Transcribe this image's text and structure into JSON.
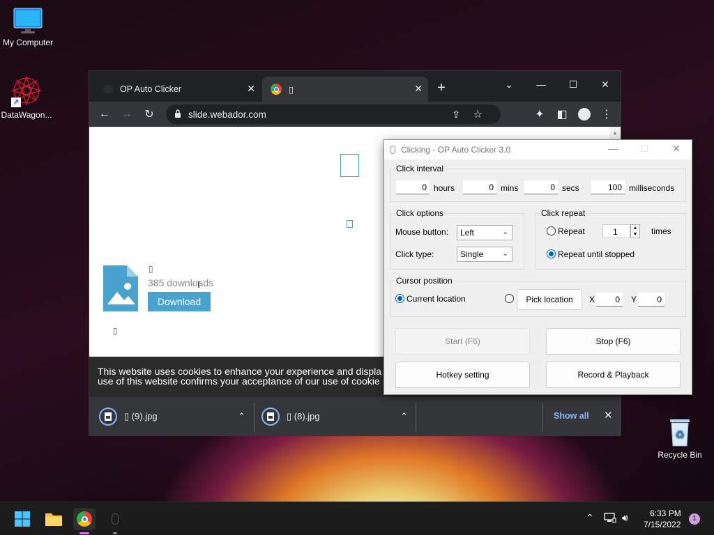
{
  "desktop": {
    "icons": [
      {
        "label": "My Computer"
      },
      {
        "label": "DataWagon..."
      },
      {
        "label": "Recycle Bin"
      }
    ]
  },
  "browser": {
    "tabs": [
      {
        "title": "OP Auto Clicker"
      },
      {
        "title": "▯"
      }
    ],
    "address": "slide.webador.com",
    "page": {
      "file_glyph": "▯",
      "downloads_count": "385 downloads",
      "download_button": "Download",
      "small_glyph": "▯"
    },
    "cookie_text_line1": "This website uses cookies to enhance your experience and displa",
    "cookie_text_line2": "use of this website confirms your acceptance of our use of cookie",
    "downloads": [
      {
        "name": "▯ (9).jpg"
      },
      {
        "name": "▯ (8).jpg"
      }
    ],
    "show_all": "Show all"
  },
  "clicker": {
    "title": "Clicking - OP Auto Clicker 3.0",
    "interval": {
      "label": "Click interval",
      "hours": "0",
      "hours_label": "hours",
      "mins": "0",
      "mins_label": "mins",
      "secs": "0",
      "secs_label": "secs",
      "ms": "100",
      "ms_label": "milliseconds"
    },
    "options": {
      "label": "Click options",
      "mouse_button_label": "Mouse button:",
      "mouse_button_value": "Left",
      "click_type_label": "Click type:",
      "click_type_value": "Single"
    },
    "repeat": {
      "label": "Click repeat",
      "repeat_label": "Repeat",
      "repeat_value": "1",
      "times_label": "times",
      "until_stopped_label": "Repeat until stopped",
      "selected": "until_stopped"
    },
    "cursor": {
      "label": "Cursor position",
      "current_label": "Current location",
      "pick_button": "Pick location",
      "x_label": "X",
      "x_value": "0",
      "y_label": "Y",
      "y_value": "0",
      "selected": "current"
    },
    "buttons": {
      "start": "Start (F6)",
      "stop": "Stop (F6)",
      "hotkey": "Hotkey setting",
      "record": "Record & Playback"
    }
  },
  "taskbar": {
    "time": "6:33 PM",
    "date": "7/15/2022",
    "notification_count": "1"
  },
  "colors": {
    "accent_blue": "#0060c0",
    "download_btn": "#4aa3cf",
    "file_icon": "#4aa3cf",
    "chrome_dark": "#202124",
    "chrome_toolbar": "#35363a"
  }
}
